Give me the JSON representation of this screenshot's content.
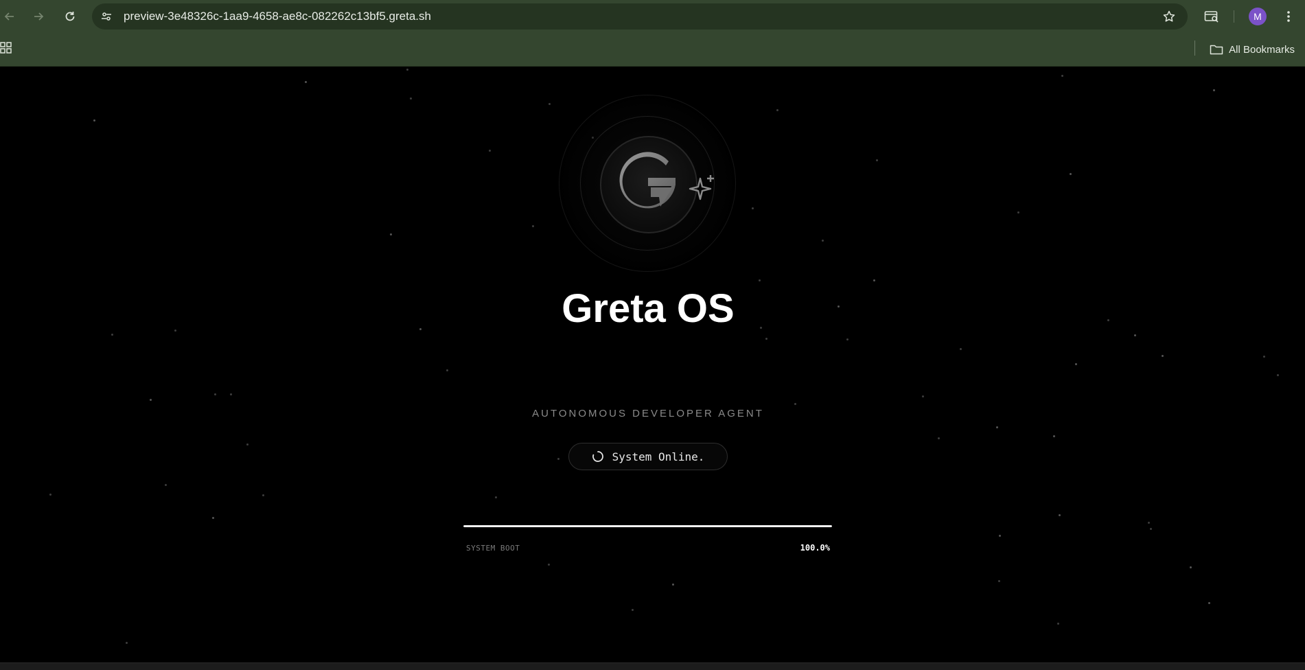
{
  "browser": {
    "url": "preview-3e48326c-1aa9-4658-ae8c-082262c13bf5.greta.sh",
    "avatar_letter": "M",
    "bookmarks_label": "All Bookmarks",
    "icons": {
      "back": "arrow-left-icon",
      "forward": "arrow-right-icon",
      "reload": "reload-icon",
      "site_info": "tune-icon",
      "bookmark_star": "star-icon",
      "search_tab": "tab-search-icon",
      "menu": "kebab-menu-icon",
      "apps": "apps-grid-icon",
      "folder": "folder-icon"
    }
  },
  "app": {
    "title": "Greta OS",
    "subtitle": "AUTONOMOUS DEVELOPER AGENT",
    "status": "System Online.",
    "boot_label": "SYSTEM BOOT",
    "boot_progress_text": "100.0%",
    "boot_progress": 1.0,
    "colors": {
      "background": "#000000",
      "title": "#ffffff",
      "subtitle": "#8a8a8a",
      "progress": "#f2f2f2",
      "chrome": "#34462f"
    }
  }
}
